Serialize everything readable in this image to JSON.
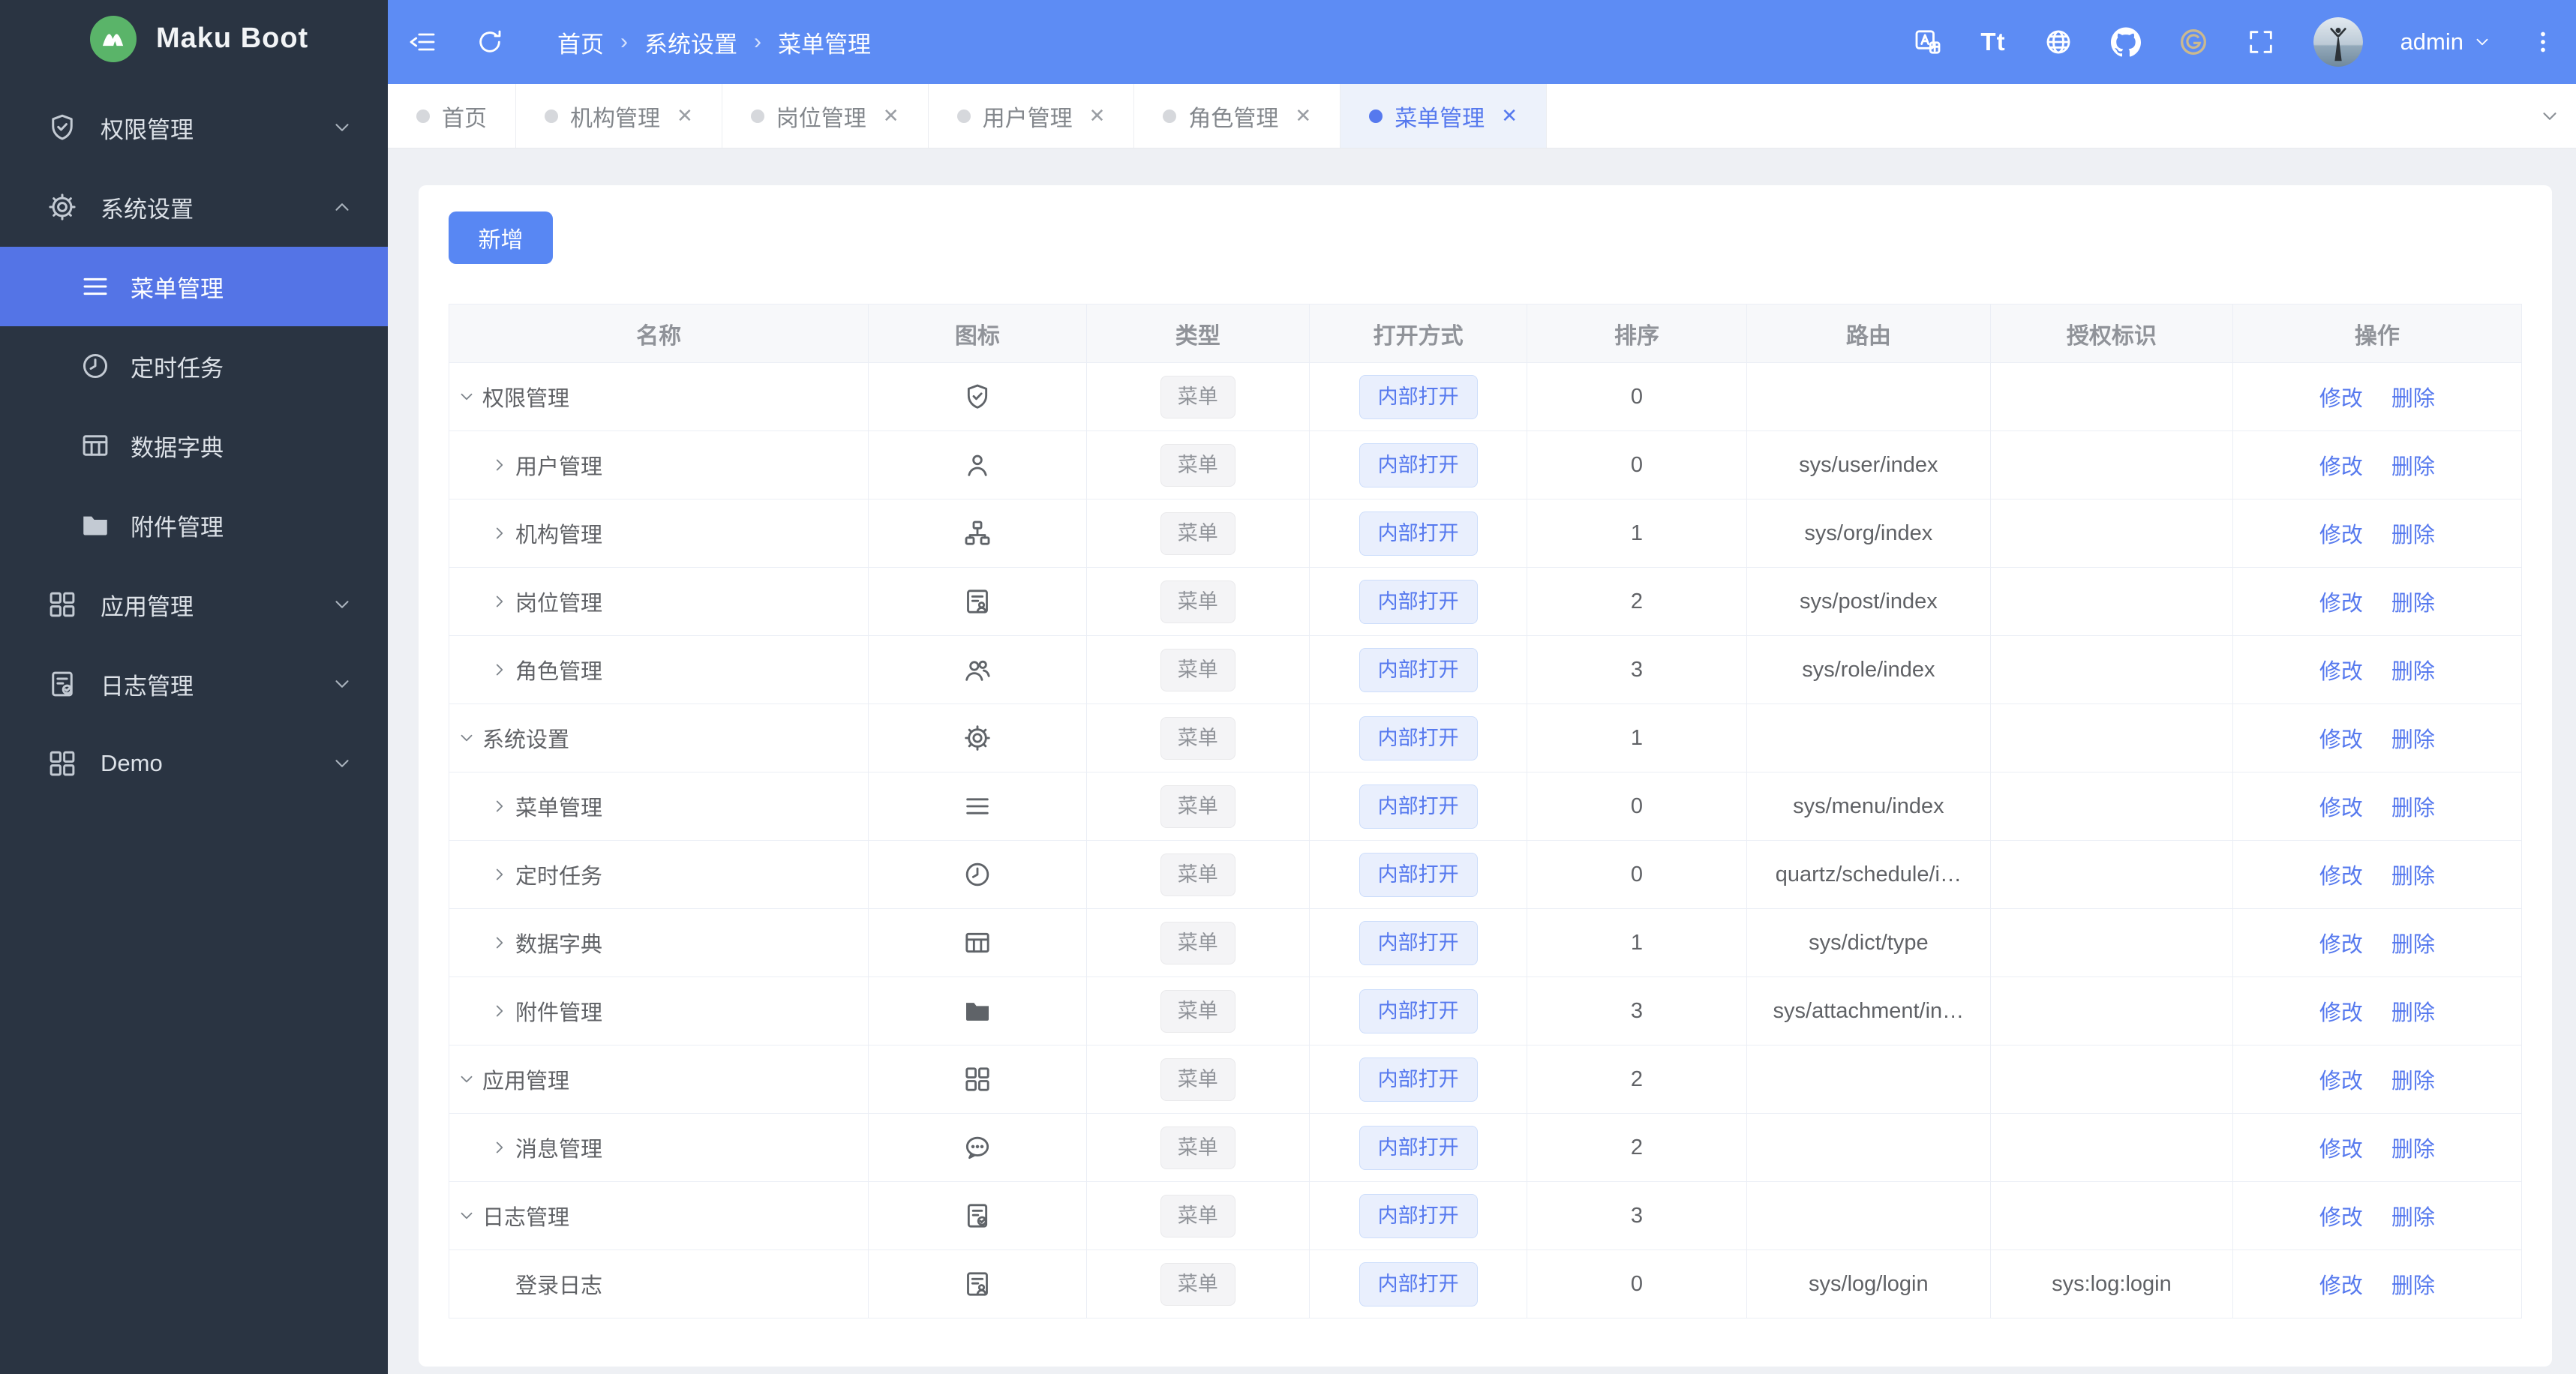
{
  "brand": {
    "name": "Maku Boot"
  },
  "colors": {
    "header_blue": "#5d8cf4",
    "sidebar_bg": "#2a3442",
    "sidebar_active": "#5474e6",
    "primary": "#5679ee",
    "logo_green": "#5ab469",
    "content_bg": "#eef0f4",
    "tag_info_text": "#909399",
    "tag_primary_bg": "#e9effd"
  },
  "sidebar": {
    "items": [
      {
        "label": "权限管理",
        "icon": "shield-check-icon",
        "level": 0,
        "chevron": "down",
        "active": false
      },
      {
        "label": "系统设置",
        "icon": "gear-icon",
        "level": 0,
        "chevron": "up",
        "active": false
      },
      {
        "label": "菜单管理",
        "icon": "menu-lines-icon",
        "level": 1,
        "chevron": null,
        "active": true
      },
      {
        "label": "定时任务",
        "icon": "clock-icon",
        "level": 1,
        "chevron": null,
        "active": false
      },
      {
        "label": "数据字典",
        "icon": "table-icon",
        "level": 1,
        "chevron": null,
        "active": false
      },
      {
        "label": "附件管理",
        "icon": "folder-icon",
        "level": 1,
        "chevron": null,
        "active": false
      },
      {
        "label": "应用管理",
        "icon": "grid-icon",
        "level": 0,
        "chevron": "down",
        "active": false
      },
      {
        "label": "日志管理",
        "icon": "doc-check-icon",
        "level": 0,
        "chevron": "down",
        "active": false
      },
      {
        "label": "Demo",
        "icon": "grid-icon",
        "level": 0,
        "chevron": "down",
        "active": false
      }
    ]
  },
  "header": {
    "breadcrumb": [
      "首页",
      "系统设置",
      "菜单管理"
    ],
    "right_icons": [
      "translate-icon",
      "font-size-icon",
      "globe-icon",
      "github-icon",
      "gitee-icon",
      "fullscreen-icon"
    ],
    "user": "admin"
  },
  "tabs": [
    {
      "label": "首页",
      "closable": false,
      "active": false
    },
    {
      "label": "机构管理",
      "closable": true,
      "active": false
    },
    {
      "label": "岗位管理",
      "closable": true,
      "active": false
    },
    {
      "label": "用户管理",
      "closable": true,
      "active": false
    },
    {
      "label": "角色管理",
      "closable": true,
      "active": false
    },
    {
      "label": "菜单管理",
      "closable": true,
      "active": true
    }
  ],
  "toolbar": {
    "add_label": "新增"
  },
  "table": {
    "columns": [
      "名称",
      "图标",
      "类型",
      "打开方式",
      "排序",
      "路由",
      "授权标识",
      "操作"
    ],
    "type_tag": "菜单",
    "open_tag": "内部打开",
    "actions": {
      "edit": "修改",
      "delete": "删除"
    },
    "rows": [
      {
        "name": "权限管理",
        "icon": "shield-check-icon",
        "level": 0,
        "expand": "expanded",
        "sort": "0",
        "route": "",
        "auth": ""
      },
      {
        "name": "用户管理",
        "icon": "user-icon",
        "level": 1,
        "expand": "collapsed",
        "sort": "0",
        "route": "sys/user/index",
        "auth": ""
      },
      {
        "name": "机构管理",
        "icon": "sitemap-icon",
        "level": 1,
        "expand": "collapsed",
        "sort": "1",
        "route": "sys/org/index",
        "auth": ""
      },
      {
        "name": "岗位管理",
        "icon": "id-card-icon",
        "level": 1,
        "expand": "collapsed",
        "sort": "2",
        "route": "sys/post/index",
        "auth": ""
      },
      {
        "name": "角色管理",
        "icon": "users-icon",
        "level": 1,
        "expand": "collapsed",
        "sort": "3",
        "route": "sys/role/index",
        "auth": ""
      },
      {
        "name": "系统设置",
        "icon": "gear-icon",
        "level": 0,
        "expand": "expanded",
        "sort": "1",
        "route": "",
        "auth": ""
      },
      {
        "name": "菜单管理",
        "icon": "menu-lines-icon",
        "level": 1,
        "expand": "collapsed",
        "sort": "0",
        "route": "sys/menu/index",
        "auth": ""
      },
      {
        "name": "定时任务",
        "icon": "clock-icon",
        "level": 1,
        "expand": "collapsed",
        "sort": "0",
        "route": "quartz/schedule/i…",
        "auth": ""
      },
      {
        "name": "数据字典",
        "icon": "table-icon",
        "level": 1,
        "expand": "collapsed",
        "sort": "1",
        "route": "sys/dict/type",
        "auth": ""
      },
      {
        "name": "附件管理",
        "icon": "folder-icon",
        "level": 1,
        "expand": "collapsed",
        "sort": "3",
        "route": "sys/attachment/in…",
        "auth": ""
      },
      {
        "name": "应用管理",
        "icon": "grid-icon",
        "level": 0,
        "expand": "expanded",
        "sort": "2",
        "route": "",
        "auth": ""
      },
      {
        "name": "消息管理",
        "icon": "chat-dots-icon",
        "level": 1,
        "expand": "collapsed",
        "sort": "2",
        "route": "",
        "auth": ""
      },
      {
        "name": "日志管理",
        "icon": "doc-check-icon",
        "level": 0,
        "expand": "expanded",
        "sort": "3",
        "route": "",
        "auth": ""
      },
      {
        "name": "登录日志",
        "icon": "id-card-icon",
        "level": 1,
        "expand": "none",
        "sort": "0",
        "route": "sys/log/login",
        "auth": "sys:log:login"
      }
    ]
  }
}
